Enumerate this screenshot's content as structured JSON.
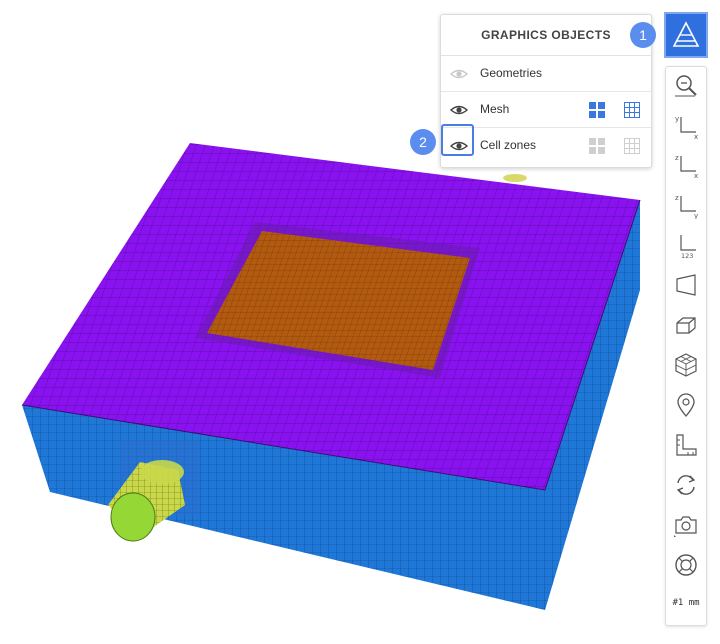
{
  "panel": {
    "title": "GRAPHICS OBJECTS",
    "rows": [
      {
        "label": "Geometries",
        "eye_state": "hidden"
      },
      {
        "label": "Mesh",
        "eye_state": "visible"
      },
      {
        "label": "Cell zones",
        "eye_state": "visible"
      }
    ]
  },
  "callouts": {
    "one": "1",
    "two": "2"
  },
  "toolbar": {
    "scale_label": "#1 mm"
  },
  "icons": [
    "search-icon",
    "eye-icon",
    "surface-display-icon",
    "wireframe-display-icon",
    "graphics-objects-icon",
    "zoom-icon",
    "view-xy-icon",
    "view-zx-icon",
    "view-zy-icon",
    "axes-123-icon",
    "perspective-icon",
    "box-icon",
    "cube-grid-icon",
    "location-pin-icon",
    "ruler-icon",
    "rotate-icon",
    "camera-icon",
    "lifebuoy-icon"
  ],
  "colors": {
    "accent": "#2f6fde",
    "callout": "#5b8def",
    "top_face": "#8b12f0",
    "side_face": "#1f78d8",
    "patch": "#b25a10",
    "cylinder": "#a8e04a"
  }
}
